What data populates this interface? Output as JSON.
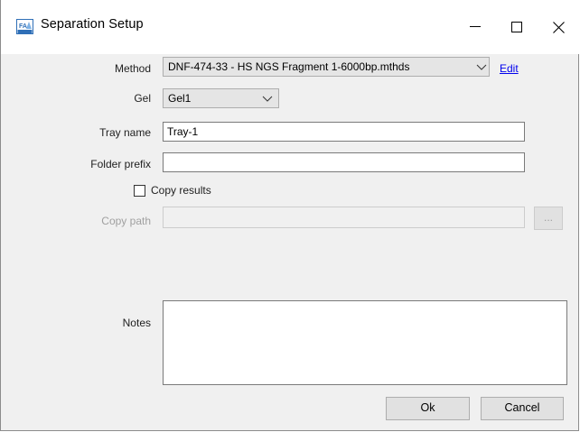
{
  "window": {
    "title": "Separation Setup",
    "icon": "fa-app-icon",
    "controls": {
      "minimize": "minimize-icon",
      "maximize": "maximize-icon",
      "close": "close-icon"
    }
  },
  "form": {
    "method": {
      "label": "Method",
      "value": "DNF-474-33 - HS NGS Fragment 1-6000bp.mthds",
      "edit_link": "Edit"
    },
    "gel": {
      "label": "Gel",
      "value": "Gel1"
    },
    "tray_name": {
      "label": "Tray name",
      "value": "Tray-1"
    },
    "folder_prefix": {
      "label": "Folder prefix",
      "value": ""
    },
    "copy_results": {
      "label": "Copy results",
      "checked": false
    },
    "copy_path": {
      "label": "Copy path",
      "value": "",
      "browse_label": "...",
      "disabled": true
    },
    "notes": {
      "label": "Notes",
      "value": ""
    }
  },
  "buttons": {
    "ok": "Ok",
    "cancel": "Cancel"
  },
  "colors": {
    "dialog_bg": "#f0f0f0",
    "titlebar_bg": "#ffffff",
    "link": "#0000ee",
    "disabled_text": "#a0a0a0"
  }
}
